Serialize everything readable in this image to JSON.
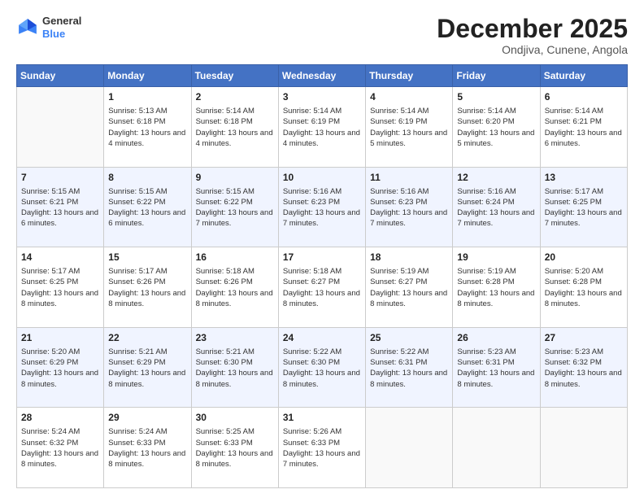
{
  "logo": {
    "line1": "General",
    "line2": "Blue"
  },
  "header": {
    "title": "December 2025",
    "subtitle": "Ondjiva, Cunene, Angola"
  },
  "days_of_week": [
    "Sunday",
    "Monday",
    "Tuesday",
    "Wednesday",
    "Thursday",
    "Friday",
    "Saturday"
  ],
  "weeks": [
    [
      {
        "day": "",
        "sunrise": "",
        "sunset": "",
        "daylight": ""
      },
      {
        "day": "1",
        "sunrise": "Sunrise: 5:13 AM",
        "sunset": "Sunset: 6:18 PM",
        "daylight": "Daylight: 13 hours and 4 minutes."
      },
      {
        "day": "2",
        "sunrise": "Sunrise: 5:14 AM",
        "sunset": "Sunset: 6:18 PM",
        "daylight": "Daylight: 13 hours and 4 minutes."
      },
      {
        "day": "3",
        "sunrise": "Sunrise: 5:14 AM",
        "sunset": "Sunset: 6:19 PM",
        "daylight": "Daylight: 13 hours and 4 minutes."
      },
      {
        "day": "4",
        "sunrise": "Sunrise: 5:14 AM",
        "sunset": "Sunset: 6:19 PM",
        "daylight": "Daylight: 13 hours and 5 minutes."
      },
      {
        "day": "5",
        "sunrise": "Sunrise: 5:14 AM",
        "sunset": "Sunset: 6:20 PM",
        "daylight": "Daylight: 13 hours and 5 minutes."
      },
      {
        "day": "6",
        "sunrise": "Sunrise: 5:14 AM",
        "sunset": "Sunset: 6:21 PM",
        "daylight": "Daylight: 13 hours and 6 minutes."
      }
    ],
    [
      {
        "day": "7",
        "sunrise": "Sunrise: 5:15 AM",
        "sunset": "Sunset: 6:21 PM",
        "daylight": "Daylight: 13 hours and 6 minutes."
      },
      {
        "day": "8",
        "sunrise": "Sunrise: 5:15 AM",
        "sunset": "Sunset: 6:22 PM",
        "daylight": "Daylight: 13 hours and 6 minutes."
      },
      {
        "day": "9",
        "sunrise": "Sunrise: 5:15 AM",
        "sunset": "Sunset: 6:22 PM",
        "daylight": "Daylight: 13 hours and 7 minutes."
      },
      {
        "day": "10",
        "sunrise": "Sunrise: 5:16 AM",
        "sunset": "Sunset: 6:23 PM",
        "daylight": "Daylight: 13 hours and 7 minutes."
      },
      {
        "day": "11",
        "sunrise": "Sunrise: 5:16 AM",
        "sunset": "Sunset: 6:23 PM",
        "daylight": "Daylight: 13 hours and 7 minutes."
      },
      {
        "day": "12",
        "sunrise": "Sunrise: 5:16 AM",
        "sunset": "Sunset: 6:24 PM",
        "daylight": "Daylight: 13 hours and 7 minutes."
      },
      {
        "day": "13",
        "sunrise": "Sunrise: 5:17 AM",
        "sunset": "Sunset: 6:25 PM",
        "daylight": "Daylight: 13 hours and 7 minutes."
      }
    ],
    [
      {
        "day": "14",
        "sunrise": "Sunrise: 5:17 AM",
        "sunset": "Sunset: 6:25 PM",
        "daylight": "Daylight: 13 hours and 8 minutes."
      },
      {
        "day": "15",
        "sunrise": "Sunrise: 5:17 AM",
        "sunset": "Sunset: 6:26 PM",
        "daylight": "Daylight: 13 hours and 8 minutes."
      },
      {
        "day": "16",
        "sunrise": "Sunrise: 5:18 AM",
        "sunset": "Sunset: 6:26 PM",
        "daylight": "Daylight: 13 hours and 8 minutes."
      },
      {
        "day": "17",
        "sunrise": "Sunrise: 5:18 AM",
        "sunset": "Sunset: 6:27 PM",
        "daylight": "Daylight: 13 hours and 8 minutes."
      },
      {
        "day": "18",
        "sunrise": "Sunrise: 5:19 AM",
        "sunset": "Sunset: 6:27 PM",
        "daylight": "Daylight: 13 hours and 8 minutes."
      },
      {
        "day": "19",
        "sunrise": "Sunrise: 5:19 AM",
        "sunset": "Sunset: 6:28 PM",
        "daylight": "Daylight: 13 hours and 8 minutes."
      },
      {
        "day": "20",
        "sunrise": "Sunrise: 5:20 AM",
        "sunset": "Sunset: 6:28 PM",
        "daylight": "Daylight: 13 hours and 8 minutes."
      }
    ],
    [
      {
        "day": "21",
        "sunrise": "Sunrise: 5:20 AM",
        "sunset": "Sunset: 6:29 PM",
        "daylight": "Daylight: 13 hours and 8 minutes."
      },
      {
        "day": "22",
        "sunrise": "Sunrise: 5:21 AM",
        "sunset": "Sunset: 6:29 PM",
        "daylight": "Daylight: 13 hours and 8 minutes."
      },
      {
        "day": "23",
        "sunrise": "Sunrise: 5:21 AM",
        "sunset": "Sunset: 6:30 PM",
        "daylight": "Daylight: 13 hours and 8 minutes."
      },
      {
        "day": "24",
        "sunrise": "Sunrise: 5:22 AM",
        "sunset": "Sunset: 6:30 PM",
        "daylight": "Daylight: 13 hours and 8 minutes."
      },
      {
        "day": "25",
        "sunrise": "Sunrise: 5:22 AM",
        "sunset": "Sunset: 6:31 PM",
        "daylight": "Daylight: 13 hours and 8 minutes."
      },
      {
        "day": "26",
        "sunrise": "Sunrise: 5:23 AM",
        "sunset": "Sunset: 6:31 PM",
        "daylight": "Daylight: 13 hours and 8 minutes."
      },
      {
        "day": "27",
        "sunrise": "Sunrise: 5:23 AM",
        "sunset": "Sunset: 6:32 PM",
        "daylight": "Daylight: 13 hours and 8 minutes."
      }
    ],
    [
      {
        "day": "28",
        "sunrise": "Sunrise: 5:24 AM",
        "sunset": "Sunset: 6:32 PM",
        "daylight": "Daylight: 13 hours and 8 minutes."
      },
      {
        "day": "29",
        "sunrise": "Sunrise: 5:24 AM",
        "sunset": "Sunset: 6:33 PM",
        "daylight": "Daylight: 13 hours and 8 minutes."
      },
      {
        "day": "30",
        "sunrise": "Sunrise: 5:25 AM",
        "sunset": "Sunset: 6:33 PM",
        "daylight": "Daylight: 13 hours and 8 minutes."
      },
      {
        "day": "31",
        "sunrise": "Sunrise: 5:26 AM",
        "sunset": "Sunset: 6:33 PM",
        "daylight": "Daylight: 13 hours and 7 minutes."
      },
      {
        "day": "",
        "sunrise": "",
        "sunset": "",
        "daylight": ""
      },
      {
        "day": "",
        "sunrise": "",
        "sunset": "",
        "daylight": ""
      },
      {
        "day": "",
        "sunrise": "",
        "sunset": "",
        "daylight": ""
      }
    ]
  ]
}
